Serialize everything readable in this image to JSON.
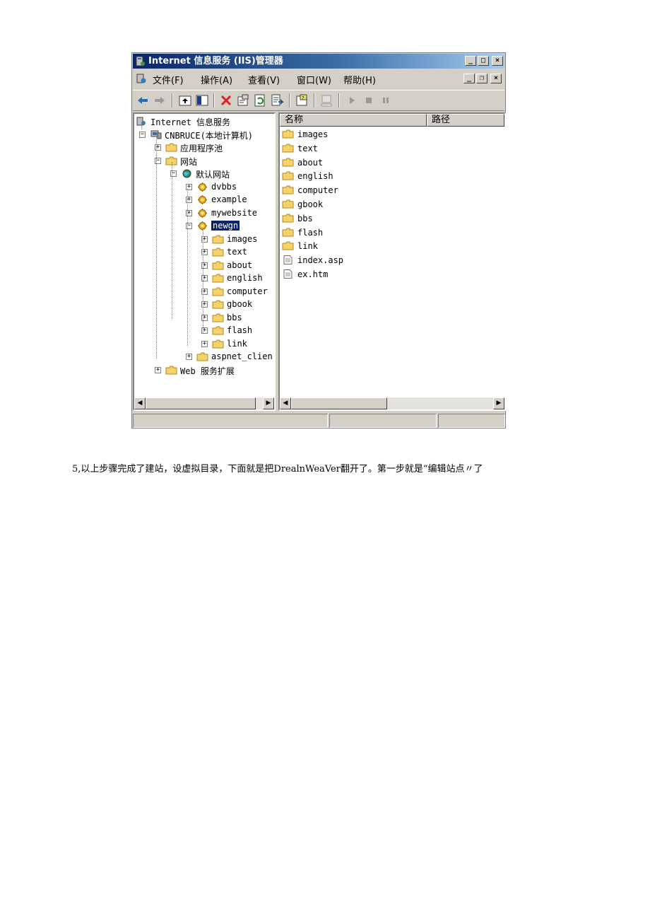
{
  "window": {
    "title": "Internet 信息服务 (IIS)管理器",
    "caption_buttons": [
      "_",
      "□",
      "×"
    ],
    "mdi_buttons": [
      "_",
      "❐",
      "×"
    ]
  },
  "menu": [
    "文件(F)",
    "操作(A)",
    "查看(V)",
    "窗口(W)",
    "帮助(H)"
  ],
  "toolbar_icons": [
    "back-arrow-icon",
    "forward-arrow-icon",
    "up-folder-icon",
    "show-tree-icon",
    "delete-icon",
    "properties-icon",
    "refresh-icon",
    "export-list-icon",
    "help-icon",
    "computer-icon",
    "play-icon",
    "stop-icon",
    "pause-icon"
  ],
  "tree": [
    {
      "label": "Internet 信息服务",
      "level": 0,
      "icon": "iis-icon",
      "toggle": ""
    },
    {
      "label": "CNBRUCE(本地计算机)",
      "level": 1,
      "icon": "computer-icon",
      "toggle": "−"
    },
    {
      "label": "应用程序池",
      "level": 2,
      "icon": "folder-icon",
      "toggle": "+"
    },
    {
      "label": "网站",
      "level": 2,
      "icon": "folder-icon",
      "toggle": "−"
    },
    {
      "label": "默认网站",
      "level": 3,
      "icon": "globe-icon",
      "toggle": "−"
    },
    {
      "label": "dvbbs",
      "level": 4,
      "icon": "web-app-icon",
      "toggle": "+"
    },
    {
      "label": "example",
      "level": 4,
      "icon": "web-app-icon",
      "toggle": "+"
    },
    {
      "label": "mywebsite",
      "level": 4,
      "icon": "web-app-icon",
      "toggle": "+"
    },
    {
      "label": "newgn",
      "level": 4,
      "icon": "web-app-icon",
      "toggle": "−",
      "selected": true
    },
    {
      "label": "images",
      "level": 5,
      "icon": "folder-icon",
      "toggle": "+"
    },
    {
      "label": "text",
      "level": 5,
      "icon": "folder-icon",
      "toggle": "+"
    },
    {
      "label": "about",
      "level": 5,
      "icon": "folder-icon",
      "toggle": "+"
    },
    {
      "label": "english",
      "level": 5,
      "icon": "folder-icon",
      "toggle": "+"
    },
    {
      "label": "computer",
      "level": 5,
      "icon": "folder-icon",
      "toggle": "+"
    },
    {
      "label": "gbook",
      "level": 5,
      "icon": "folder-icon",
      "toggle": "+"
    },
    {
      "label": "bbs",
      "level": 5,
      "icon": "folder-icon",
      "toggle": "+"
    },
    {
      "label": "flash",
      "level": 5,
      "icon": "folder-icon",
      "toggle": "+"
    },
    {
      "label": "link",
      "level": 5,
      "icon": "folder-icon",
      "toggle": "+"
    },
    {
      "label": "aspnet_clien",
      "level": 4,
      "icon": "folder-icon",
      "toggle": "+"
    },
    {
      "label": "Web 服务扩展",
      "level": 2,
      "icon": "folder-icon",
      "toggle": "+"
    }
  ],
  "list": {
    "columns": [
      "名称",
      "路径"
    ],
    "items": [
      {
        "name": "images",
        "icon": "folder-icon"
      },
      {
        "name": "text",
        "icon": "folder-icon"
      },
      {
        "name": "about",
        "icon": "folder-icon"
      },
      {
        "name": "english",
        "icon": "folder-icon"
      },
      {
        "name": "computer",
        "icon": "folder-icon"
      },
      {
        "name": "gbook",
        "icon": "folder-icon"
      },
      {
        "name": "bbs",
        "icon": "folder-icon"
      },
      {
        "name": "flash",
        "icon": "folder-icon"
      },
      {
        "name": "link",
        "icon": "folder-icon"
      },
      {
        "name": "index.asp",
        "icon": "file-icon"
      },
      {
        "name": "ex.htm",
        "icon": "file-icon"
      }
    ]
  },
  "caption": "5,以上步骤完成了建站，设虚拟目录，下面就是把DrealnWeaVer翻开了。第一步就是“编辑站点〃了"
}
